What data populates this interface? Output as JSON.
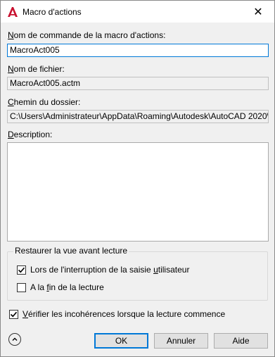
{
  "window": {
    "title": "Macro d'actions",
    "close_glyph": "✕"
  },
  "command_name": {
    "label_first": "N",
    "label_rest": "om de commande de la macro d'actions:",
    "value": "MacroAct005"
  },
  "file_name": {
    "label_first": "N",
    "label_rest": "om de fichier:",
    "value": "MacroAct005.actm"
  },
  "folder_path": {
    "label_first": "C",
    "label_rest": "hemin du dossier:",
    "value": "C:\\Users\\Administrateur\\AppData\\Roaming\\Autodesk\\AutoCAD 2020\\"
  },
  "description": {
    "label_first": "D",
    "label_rest": "escription:",
    "value": ""
  },
  "restore_view": {
    "group_label": "Restaurer la vue avant lecture",
    "option1": {
      "label_pre": "Lors de l'interruption de la saisie ",
      "label_ul": "u",
      "label_post": "tilisateur",
      "checked": true
    },
    "option2": {
      "label_pre": "A la ",
      "label_ul": "f",
      "label_post": "in de la lecture",
      "checked": false
    }
  },
  "verify": {
    "label_first": "V",
    "label_rest": "érifier les incohérences lorsque la lecture commence",
    "checked": true
  },
  "buttons": {
    "ok": "OK",
    "cancel": "Annuler",
    "help": "Aide"
  },
  "icons": {
    "app": "autocad-icon",
    "expand": "chevron-up-icon",
    "check": "check-icon"
  },
  "colors": {
    "accent": "#0078d7",
    "autocad_red": "#c8102e"
  }
}
